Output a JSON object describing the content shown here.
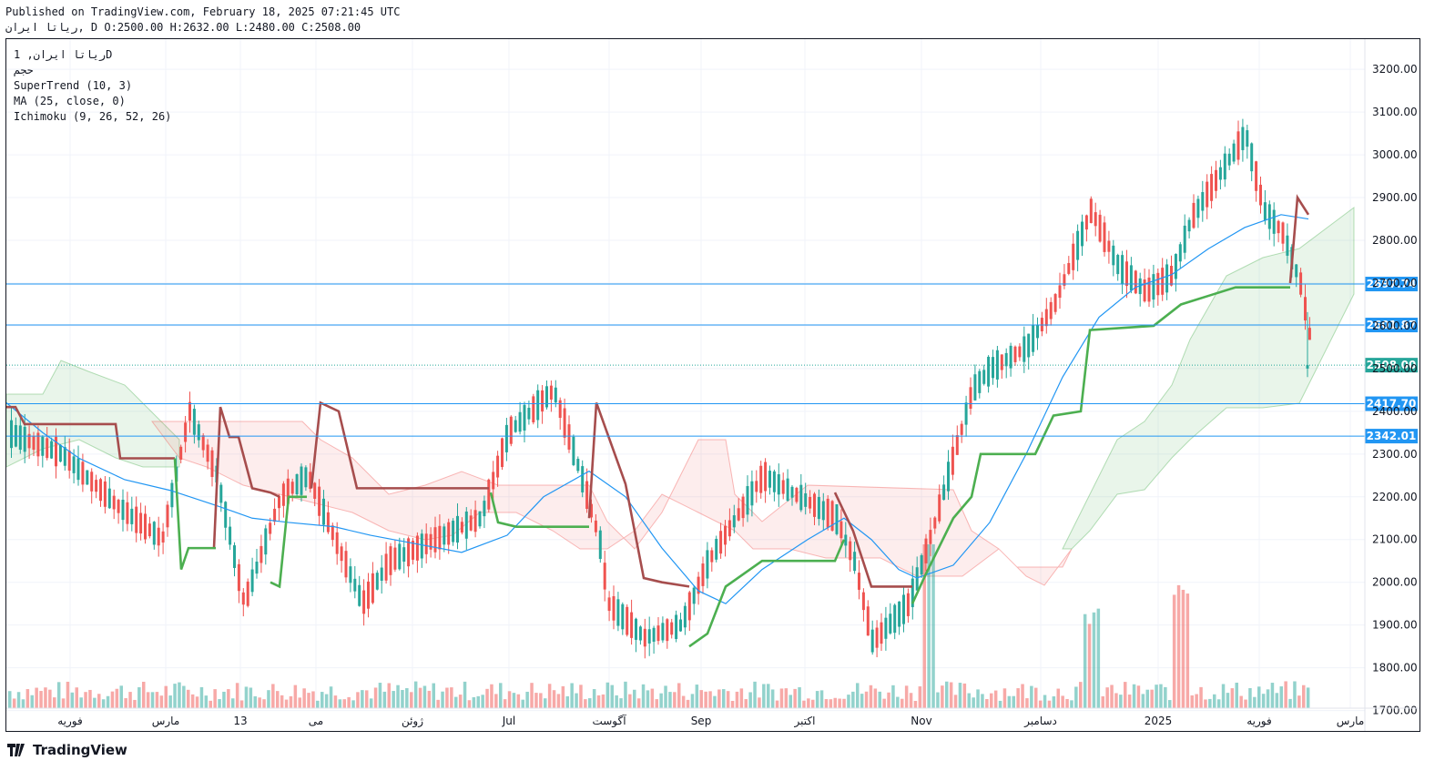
{
  "header": {
    "published": "Published on TradingView.com, February 18, 2025 07:21:45 UTC",
    "ohlc_line": "ریاتا ایران, D O:2500.00 H:2632.00 L:2480.00 C:2508.00"
  },
  "legend": {
    "symbol": "ریاتا ایران, 1D",
    "volume_label": "حجم",
    "supertrend": "SuperTrend (10, 3)",
    "ma": "MA (25, close, 0)",
    "ichimoku": "Ichimoku (9, 26, 52, 26)"
  },
  "footer": {
    "brand": "TradingView",
    "logo_icon": "tradingview-logo-icon"
  },
  "colors": {
    "up": "#26a69a",
    "down": "#ef5350",
    "supertrend_up": "#4caf50",
    "supertrend_down": "#a64d4d",
    "ma": "#2196f3",
    "hline": "#2196f3",
    "badge": "#2196f3"
  },
  "chart_data": {
    "type": "candlestick",
    "ylim": [
      1680,
      3260
    ],
    "y_ticks": [
      3200,
      3100,
      3000,
      2900,
      2800,
      2700,
      2600,
      2500,
      2400,
      2300,
      2200,
      2100,
      2000,
      1900,
      1800,
      1700
    ],
    "x_ticks": [
      "فوریه",
      "مارس",
      "13",
      "می",
      "ژوئن",
      "Jul",
      "آگوست",
      "Sep",
      "اکتبر",
      "Nov",
      "دسامبر",
      "2025",
      "فوریه",
      "مارس"
    ],
    "price_lines": [
      {
        "label": "2697.74",
        "value": 2697.74
      },
      {
        "label": "2601.87",
        "value": 2601.87
      },
      {
        "label": "2508.00",
        "value": 2508.0,
        "current": true
      },
      {
        "label": "2417.70",
        "value": 2417.7
      },
      {
        "label": "2342.01",
        "value": 2342.01
      }
    ],
    "last": {
      "open": 2500.0,
      "high": 2632.0,
      "low": 2480.0,
      "close": 2508.0
    }
  }
}
